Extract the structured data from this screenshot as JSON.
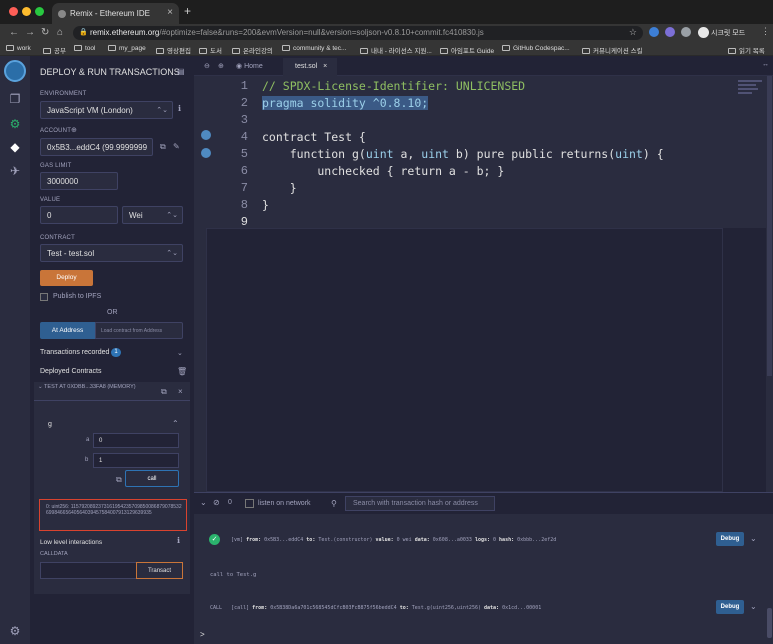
{
  "browser": {
    "tab_title": "Remix - Ethereum IDE",
    "url_host": "remix.ethereum.org",
    "url_rest": "/#optimize=false&runs=200&evmVersion=null&version=soljson-v0.8.10+commit.fc410830.js",
    "profile_label": "시크릿 모드",
    "bookmarks": [
      "work",
      "공부",
      "tool",
      "my_page",
      "영상편집",
      "도서",
      "온라인강의",
      "community & tec...",
      "내내 - 라이선스 지원...",
      "아임포트 Guide",
      "GitHub Codespac...",
      "커뮤니케이션 스킬"
    ],
    "reading_list": "읽기 목록"
  },
  "panel": {
    "title": "DEPLOY & RUN TRANSACTIONS",
    "environment_label": "ENVIRONMENT",
    "environment_value": "JavaScript VM (London)",
    "account_label": "ACCOUNT",
    "account_value": "0x5B3...eddC4 (99.9999999",
    "gas_limit_label": "GAS LIMIT",
    "gas_limit_value": "3000000",
    "value_label": "VALUE",
    "value_amount": "0",
    "value_unit": "Wei",
    "contract_label": "CONTRACT",
    "contract_value": "Test - test.sol",
    "deploy_label": "Deploy",
    "publish_label": "Publish to IPFS",
    "or_label": "OR",
    "at_address_label": "At Address",
    "load_contract_placeholder": "Load contract from Address",
    "tx_recorded_label": "Transactions recorded",
    "tx_recorded_count": "1",
    "deployed_label": "Deployed Contracts",
    "instance_title": "TEST AT 0XDBB...33FA8 (MEMORY)",
    "function_name": "g",
    "arg_a_name": "a",
    "arg_a_value": "0",
    "arg_b_name": "b",
    "arg_b_value": "1",
    "call_label": "call",
    "output": "0: uint256: 115792089237316195423570985008687907853269984665640564039457584007913129639935",
    "low_level_label": "Low level interactions",
    "calldata_label": "CALLDATA",
    "transact_label": "Transact"
  },
  "editor": {
    "home_tab": "Home",
    "file_tab": "test.sol",
    "line_numbers": [
      "1",
      "2",
      "3",
      "4",
      "5",
      "6",
      "7",
      "8",
      "9"
    ],
    "code": {
      "l1": "// SPDX-License-Identifier: UNLICENSED",
      "l2": "pragma solidity ^0.8.10;",
      "l4": "contract Test {",
      "l5a": "    function g(",
      "l5b": "uint",
      "l5c": " a, ",
      "l5d": "uint",
      "l5e": " b) pure public returns(",
      "l5f": "uint",
      "l5g": ") {",
      "l6": "        unchecked { return a - b; }",
      "l7": "    }",
      "l8": "}"
    }
  },
  "terminal": {
    "count": "0",
    "listen_label": "listen on network",
    "search_placeholder": "Search with transaction hash or address",
    "log1_prefix": "[vm]",
    "log1_from_k": "from:",
    "log1_from_v": "0x5B3...eddC4",
    "log1_to_k": "to:",
    "log1_to_v": "Test.(constructor)",
    "log1_value_k": "value:",
    "log1_value_v": "0 wei",
    "log1_data_k": "data:",
    "log1_data_v": "0x608...a0033",
    "log1_logs_k": "logs:",
    "log1_logs_v": "0",
    "log1_hash_k": "hash:",
    "log1_hash_v": "0xbbb...2ef2d",
    "log2": "call to Test.g",
    "log3_prefix": "CALL",
    "log3_tag": "[call]",
    "log3_from_k": "from:",
    "log3_from_v": "0x5B38Da6a701c568545dCfcB03FcB875f56beddC4",
    "log3_to_k": "to:",
    "log3_to_v": "Test.g(uint256,uint256)",
    "log3_data_k": "data:",
    "log3_data_v": "0x1cd...00001",
    "debug_label": "Debug",
    "prompt": ">"
  },
  "colors": {
    "accent_orange": "#c97539",
    "accent_blue": "#2f5f91",
    "output_border": "#d9432f",
    "success": "#2bb36d"
  }
}
